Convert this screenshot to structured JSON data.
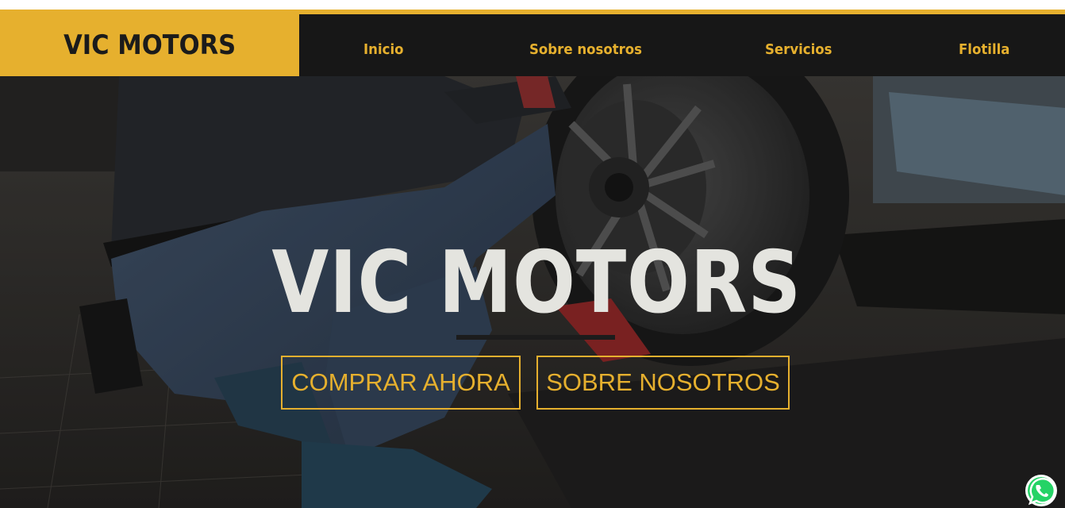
{
  "header": {
    "brand": "VIC MOTORS",
    "nav": [
      {
        "label": "Inicio"
      },
      {
        "label": "Sobre nosotros"
      },
      {
        "label": "Servicios"
      },
      {
        "label": "Flotilla"
      }
    ]
  },
  "hero": {
    "title": "VIC MOTORS",
    "buttons": {
      "buy_label": "COMPRAR AHORA",
      "about_label": "SOBRE NOSOTROS"
    },
    "background_icon": "mechanic-changing-tire-photo"
  },
  "floating": {
    "whatsapp_icon": "whatsapp-icon"
  },
  "colors": {
    "accent": "#e6b02e",
    "dark": "#171717",
    "hero_title": "#e4e4df"
  }
}
